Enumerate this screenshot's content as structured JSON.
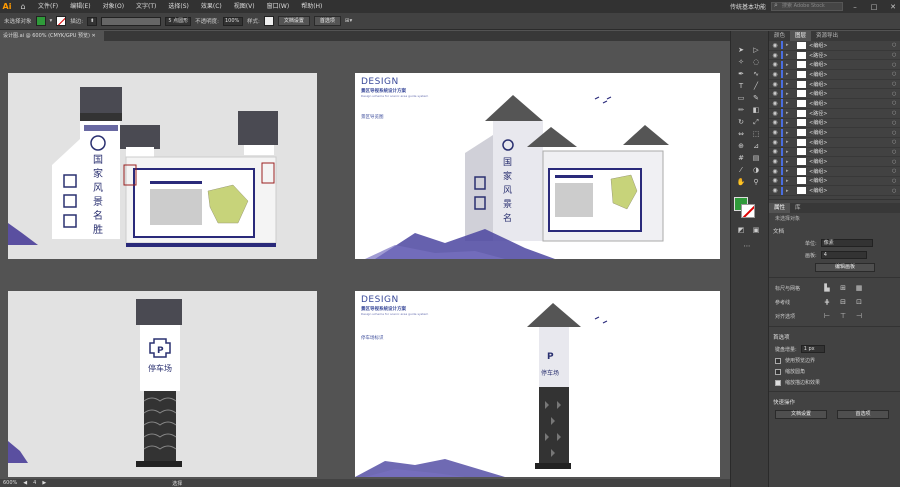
{
  "app": {
    "logo": "Ai"
  },
  "menu": [
    "文件(F)",
    "编辑(E)",
    "对象(O)",
    "文字(T)",
    "选择(S)",
    "效果(C)",
    "视图(V)",
    "窗口(W)",
    "帮助(H)"
  ],
  "workspace": {
    "label": "传统基本功能",
    "search_placeholder": "搜索 Adobe Stock"
  },
  "control": {
    "selection_label": "未选择对象",
    "stroke_label": "描边:",
    "brush_label": "5 点圆形",
    "opacity_label": "不透明度:",
    "opacity_value": "100%",
    "style_label": "样式:",
    "doc_setup": "文档设置",
    "prefs": "首选项"
  },
  "document_tab": "设计图.ai @ 600% (CMYK/GPU 预览)",
  "artboards": {
    "design_title": "DESIGN",
    "subtitle": "景区导视系统设计方案",
    "subtitle2": "Design scheme for scenic area guide system",
    "ab2_label": "景区导览图",
    "ab4_label": "停车场标识",
    "sign_text": "国家风景名胜区",
    "map_title": "国家风景名胜区"
  },
  "status": {
    "zoom": "600%",
    "page": "4",
    "mode": "选择"
  },
  "panels": {
    "tabs": [
      "颜色",
      "图层",
      "资源导出"
    ],
    "layers": [
      "<编组>",
      "<路径>",
      "<编组>",
      "<编组>",
      "<编组>",
      "<编组>",
      "<编组>",
      "<路径>",
      "<编组>",
      "<编组>",
      "<编组>",
      "<编组>",
      "<编组>",
      "<编组>",
      "<编组>",
      "<编组>"
    ],
    "prop_tabs": [
      "属性",
      "库"
    ],
    "none_selected": "未选择对象",
    "document": "文档",
    "units_label": "单位:",
    "units_value": "像素",
    "artboard_label": "画板:",
    "artboard_value": "4",
    "edit_artboard": "编辑画板",
    "ruler_grid": "标尺与网格",
    "guides": "参考线",
    "align": "对齐选项",
    "prefs_title": "首选项",
    "keyboard_inc_label": "键盘增量:",
    "keyboard_inc_value": "1 px",
    "check1": "使用预览边界",
    "check2": "缩放圆角",
    "check3": "缩放描边和效果",
    "quick_actions": "快速操作",
    "doc_setup_btn": "文档设置",
    "prefs_btn": "首选项"
  },
  "colors": {
    "accent_blue": "#3a4a9a",
    "fill": "#2f9a3a"
  }
}
